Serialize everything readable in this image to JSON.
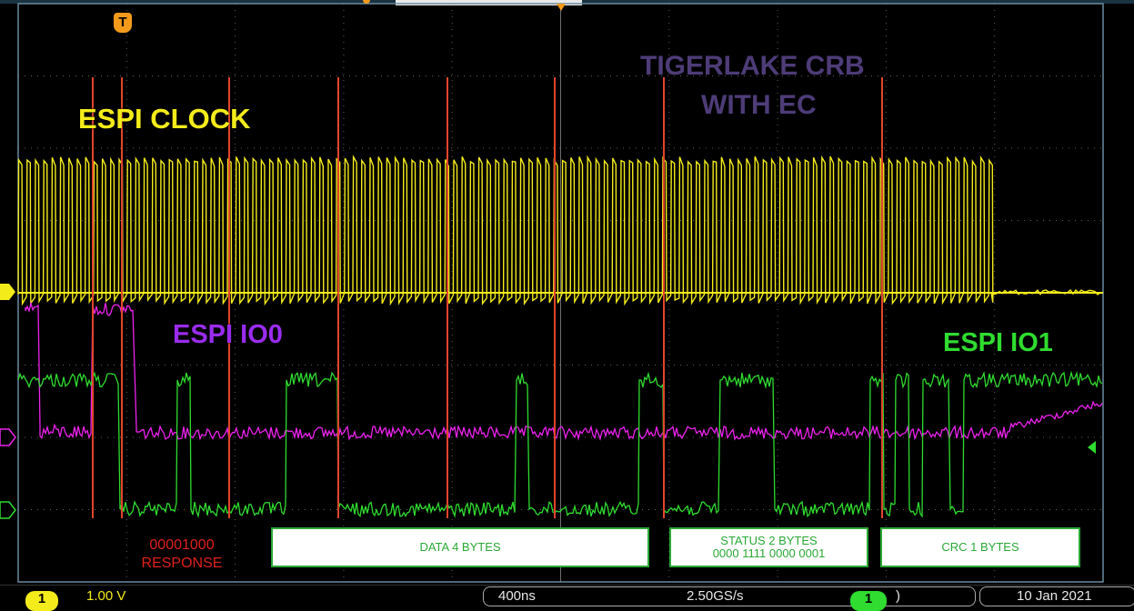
{
  "labels": {
    "clock": "ESPI CLOCK",
    "io0": "ESPI IO0",
    "io1": "ESPI IO1",
    "board_line1": "TIGERLAKE CRB",
    "board_line2": "WITH EC"
  },
  "trigger_marker": "T",
  "annotations": {
    "response_bits": "00001000",
    "response_label": "RESPONSE",
    "data_box": "DATA 4 BYTES",
    "status_line1": "STATUS 2 BYTES",
    "status_line2": "0000 1111 0000 0001",
    "crc_box": "CRC 1 BYTES"
  },
  "statusbar": {
    "ch1_badge": "1",
    "ch1_scale": "1.00 V",
    "timebase": "400ns",
    "sample_rate": "2.50GS/s",
    "trig_badge": "1",
    "date": "10 Jan 2021"
  },
  "colors": {
    "clock": "#f4ec1a",
    "io0": "#ee22ee",
    "io1": "#2fdc2f",
    "cursor": "#e2452b",
    "board_text": "#4e3c78",
    "io0_label": "#9a2cf0",
    "grid": "#8a8a8a"
  }
}
